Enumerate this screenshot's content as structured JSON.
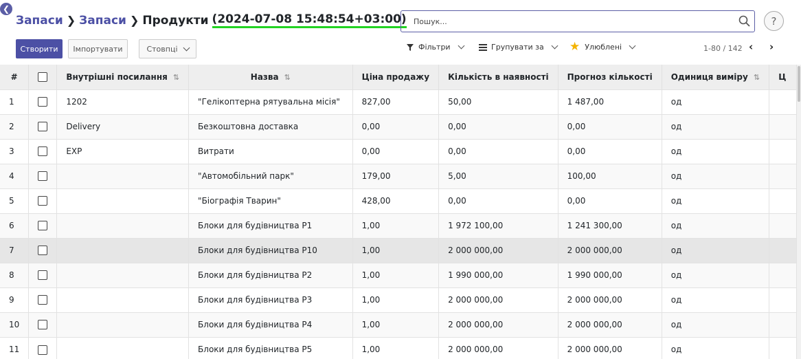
{
  "breadcrumb": {
    "items": [
      "Запаси",
      "Запаси"
    ],
    "current": "Продукти",
    "date": "(2024-07-08 15:48:54+03:00)"
  },
  "search": {
    "placeholder": "Пошук..."
  },
  "help_label": "?",
  "buttons": {
    "create": "Створити",
    "import": "Імпортувати",
    "columns": "Стовпці"
  },
  "controls": {
    "filters": "Фільтри",
    "group_by": "Групувати за",
    "favorites": "Улюблені"
  },
  "pager": {
    "range": "1-80 / 142"
  },
  "colors": {
    "accent": "#4c50a5",
    "highlight": "#22d322",
    "star": "#f3b300"
  },
  "table": {
    "columns": [
      "#",
      "",
      "Внутрішні посилання",
      "Назва",
      "Ціна продажу",
      "Кількість в наявності",
      "Прогноз кількості",
      "Одиниця виміру",
      "Ц"
    ],
    "rows": [
      [
        "1",
        "1202",
        "\"Гелікоптерна рятувальна місія\"",
        "827,00",
        "50,00",
        "1 487,00",
        "од"
      ],
      [
        "2",
        "Delivery",
        "Безкоштовна доставка",
        "0,00",
        "0,00",
        "0,00",
        "од"
      ],
      [
        "3",
        "EXP",
        "Витрати",
        "0,00",
        "0,00",
        "0,00",
        "од"
      ],
      [
        "4",
        "",
        "\"Автомобільний парк\"",
        "179,00",
        "5,00",
        "100,00",
        "од"
      ],
      [
        "5",
        "",
        "\"Біографія Тварин\"",
        "428,00",
        "0,00",
        "0,00",
        "од"
      ],
      [
        "6",
        "",
        "Блоки для будівництва P1",
        "1,00",
        "1 972 100,00",
        "1 241 300,00",
        "од"
      ],
      [
        "7",
        "",
        "Блоки для будівництва P10",
        "1,00",
        "2 000 000,00",
        "2 000 000,00",
        "од"
      ],
      [
        "8",
        "",
        "Блоки для будівництва P2",
        "1,00",
        "1 990 000,00",
        "1 990 000,00",
        "од"
      ],
      [
        "9",
        "",
        "Блоки для будівництва P3",
        "1,00",
        "2 000 000,00",
        "2 000 000,00",
        "од"
      ],
      [
        "10",
        "",
        "Блоки для будівництва P4",
        "1,00",
        "2 000 000,00",
        "2 000 000,00",
        "од"
      ],
      [
        "11",
        "",
        "Блоки для будівництва P5",
        "1,00",
        "2 000 000,00",
        "2 000 000,00",
        "од"
      ]
    ]
  }
}
